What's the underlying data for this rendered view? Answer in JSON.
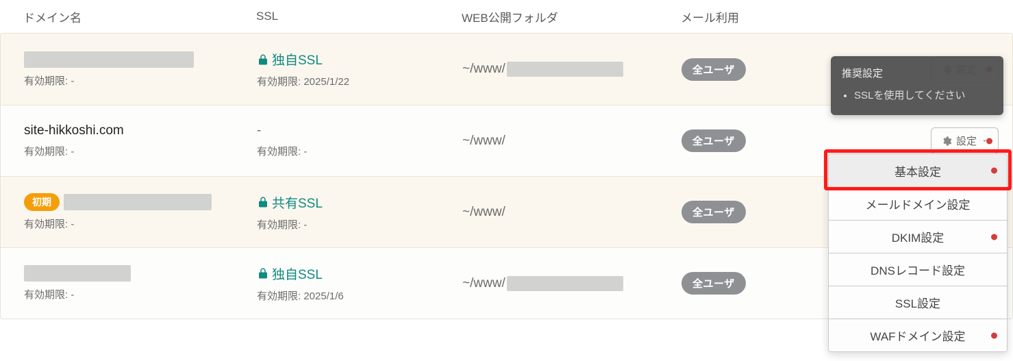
{
  "headers": {
    "domain": "ドメイン名",
    "ssl": "SSL",
    "folder": "WEB公開フォルダ",
    "mail": "メール利用"
  },
  "labels": {
    "expiry_prefix": "有効期限: ",
    "settings": "設定",
    "initial_badge": "初期"
  },
  "rows": [
    {
      "domain_text": "",
      "domain_redacted": true,
      "domain_redact_w": 248,
      "initial": false,
      "domain_expiry": "-",
      "ssl_type": "独自SSL",
      "ssl_has_lock": true,
      "ssl_expiry": "2025/1/22",
      "folder_prefix": "~/www/",
      "folder_redacted": true,
      "folder_redact_w": 170,
      "mail_badge": "全ユーザ"
    },
    {
      "domain_text": "site-hikkoshi.com",
      "domain_redacted": false,
      "domain_redact_w": 0,
      "initial": false,
      "domain_expiry": "-",
      "ssl_type": "-",
      "ssl_has_lock": false,
      "ssl_expiry": "-",
      "folder_prefix": "~/www/",
      "folder_redacted": false,
      "folder_redact_w": 0,
      "mail_badge": "全ユーザ"
    },
    {
      "domain_text": "",
      "domain_redacted": true,
      "domain_redact_w": 216,
      "initial": true,
      "domain_expiry": "-",
      "ssl_type": "共有SSL",
      "ssl_has_lock": true,
      "ssl_expiry": "-",
      "folder_prefix": "~/www/",
      "folder_redacted": false,
      "folder_redact_w": 0,
      "mail_badge": "全ユーザ"
    },
    {
      "domain_text": "",
      "domain_redacted": true,
      "domain_redact_w": 156,
      "initial": false,
      "domain_expiry": "-",
      "ssl_type": "独自SSL",
      "ssl_has_lock": true,
      "ssl_expiry": "2025/1/6",
      "folder_prefix": "~/www/",
      "folder_redacted": true,
      "folder_redact_w": 170,
      "mail_badge": "全ユーザ"
    }
  ],
  "tooltip": {
    "title": "推奨設定",
    "items": [
      "SSLを使用してください"
    ]
  },
  "dropdown": [
    {
      "label": "基本設定",
      "dot": true,
      "hover": true
    },
    {
      "label": "メールドメイン設定",
      "dot": false,
      "hover": false
    },
    {
      "label": "DKIM設定",
      "dot": true,
      "hover": false
    },
    {
      "label": "DNSレコード設定",
      "dot": false,
      "hover": false
    },
    {
      "label": "SSL設定",
      "dot": false,
      "hover": false
    },
    {
      "label": "WAFドメイン設定",
      "dot": true,
      "hover": false
    }
  ]
}
